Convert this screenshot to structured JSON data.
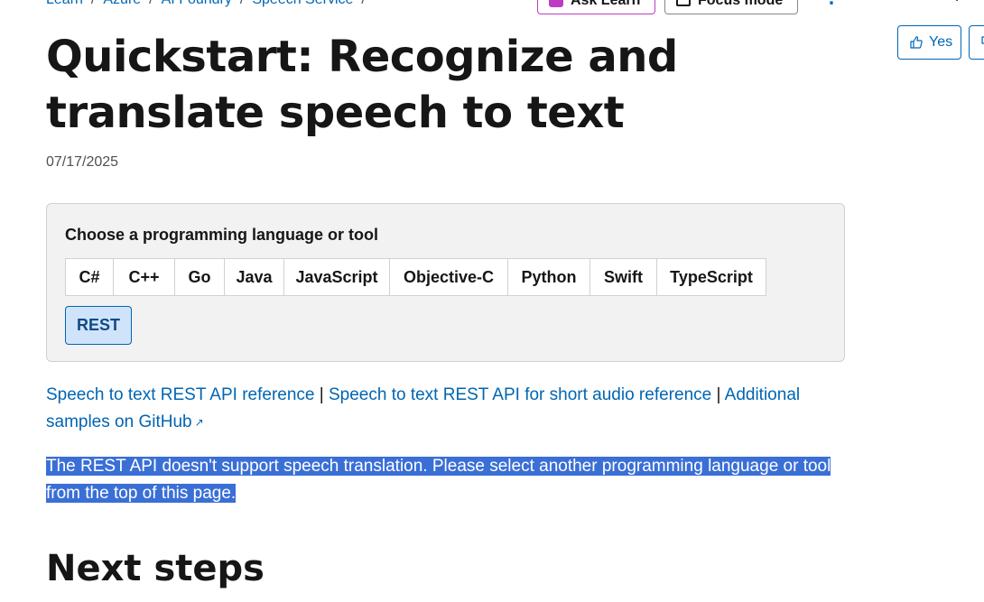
{
  "breadcrumb": {
    "items": [
      "Learn",
      "Azure",
      "AI Foundry",
      "Speech Service"
    ],
    "separator": "/"
  },
  "header_actions": {
    "ask_label": "Ask Learn",
    "focus_label": "Focus mode",
    "more_icon": "more-icon",
    "edge_glyph": "P"
  },
  "feedback": {
    "yes_label": "Yes"
  },
  "article": {
    "title": "Quickstart: Recognize and translate speech to text",
    "date": "07/17/2025"
  },
  "chooser": {
    "label": "Choose a programming language or tool",
    "languages": [
      "C#",
      "C++",
      "Go",
      "Java",
      "JavaScript",
      "Objective-C",
      "Python",
      "Swift",
      "TypeScript"
    ],
    "selected": "REST"
  },
  "links": {
    "link1": "Speech to text REST API reference",
    "sep": "|",
    "link2": "Speech to text REST API for short audio reference",
    "link3": "Additional samples on GitHub"
  },
  "notice": {
    "text": "The REST API doesn't support speech translation. Please select another programming language or tool from the top of this page."
  },
  "next_steps": {
    "heading": "Next steps"
  },
  "colors": {
    "link": "#0065b3",
    "selection": "#3a6fd6",
    "selected_tab": "#cfe4fa",
    "ask_accent": "#c03bc4"
  }
}
